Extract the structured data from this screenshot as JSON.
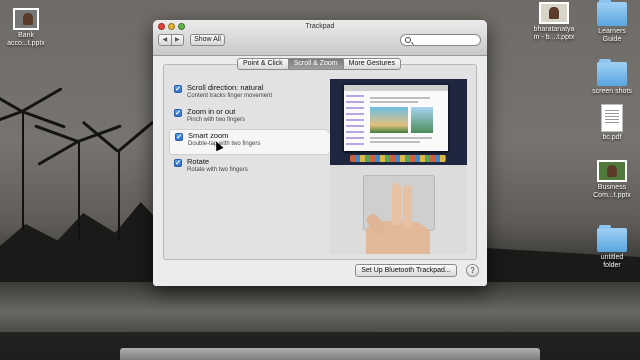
{
  "window": {
    "title": "Trackpad",
    "show_all": "Show All",
    "search_value": "",
    "nav_back": "◀",
    "nav_forward": "▶"
  },
  "tabs": [
    {
      "label": "Point & Click",
      "active": false
    },
    {
      "label": "Scroll & Zoom",
      "active": true
    },
    {
      "label": "More Gestures",
      "active": false
    }
  ],
  "options": [
    {
      "title": "Scroll direction: natural",
      "subtitle": "Content tracks finger movement",
      "checked": true,
      "selected": false
    },
    {
      "title": "Zoom in or out",
      "subtitle": "Pinch with two fingers",
      "checked": true,
      "selected": false
    },
    {
      "title": "Smart zoom",
      "subtitle": "Double-tap with two fingers",
      "checked": true,
      "selected": true
    },
    {
      "title": "Rotate",
      "subtitle": "Rotate with two fingers",
      "checked": true,
      "selected": false
    }
  ],
  "buttons": {
    "bluetooth": "Set Up Bluetooth Trackpad...",
    "help": "?"
  },
  "desktop_icons": {
    "bank": "Bank\nacco...t.pptx",
    "bharatanatya": "bharatanatya\nm - b....t.pptx",
    "learners_guide": "Learners\nGuide",
    "screen_shots": "screen shots",
    "bc_pdf": "bc.pdf",
    "business": "Business\nCom...t.pptx",
    "untitled_folder": "untitled\nfolder"
  },
  "colors": {
    "accent": "#2b6fc9",
    "window_bg": "#ececec"
  }
}
